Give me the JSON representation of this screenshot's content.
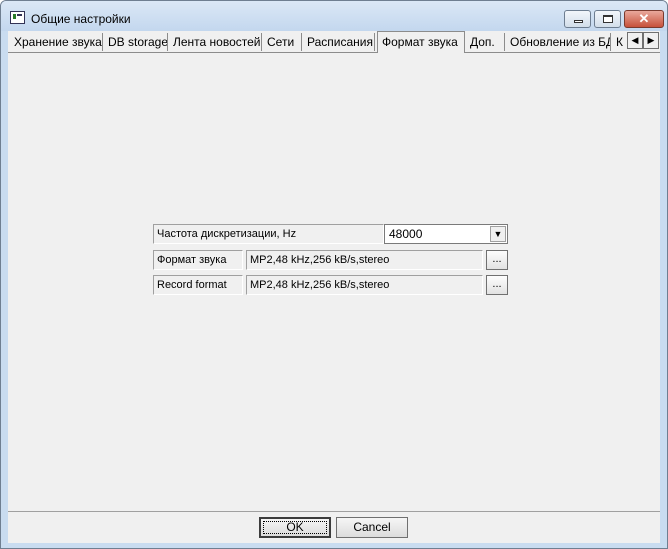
{
  "window": {
    "title": "Общие настройки",
    "close_glyph": "✕"
  },
  "tabs": [
    {
      "label": "Хранение звука",
      "active": false
    },
    {
      "label": "DB storage",
      "active": false
    },
    {
      "label": "Лента новостей",
      "active": false
    },
    {
      "label": "Сети",
      "active": false
    },
    {
      "label": "Расписания",
      "active": false
    },
    {
      "label": "Формат звука",
      "active": true
    },
    {
      "label": "Доп.",
      "active": false
    },
    {
      "label": "Обновление из БД",
      "active": false
    },
    {
      "label": "К",
      "active": false
    }
  ],
  "tab_scroll": {
    "left": "◀",
    "right": "▶"
  },
  "form": {
    "sample_rate": {
      "label": "Частота дискретизации, Hz",
      "value": "48000",
      "arrow": "▼"
    },
    "sound_format": {
      "label": "Формат звука",
      "value": "MP2,48 kHz,256 kB/s,stereo",
      "browse": "..."
    },
    "record_format": {
      "label": "Record format",
      "value": "MP2,48 kHz,256 kB/s,stereo",
      "browse": "..."
    }
  },
  "buttons": {
    "ok": "OK",
    "cancel": "Cancel"
  }
}
